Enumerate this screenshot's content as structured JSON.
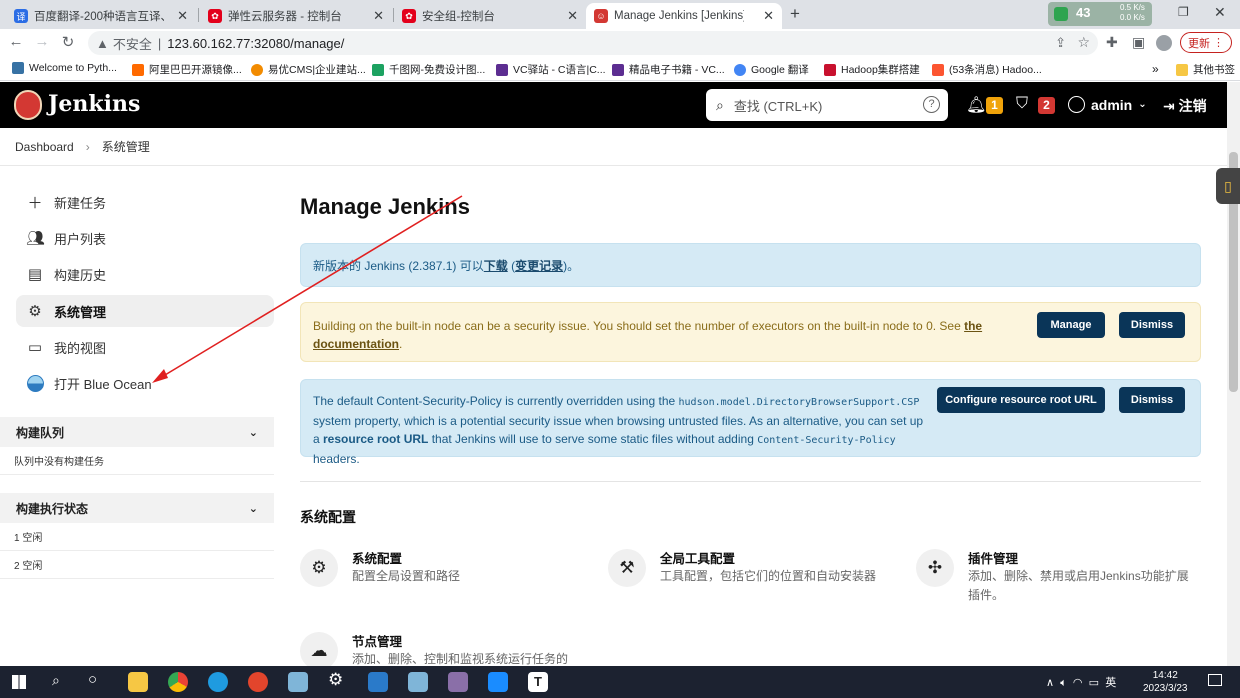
{
  "browser": {
    "tabs": [
      {
        "title": "百度翻译-200种语言互译、沟通",
        "icon": "baidu-translate-icon",
        "color": "#2b6de5"
      },
      {
        "title": "弹性云服务器 - 控制台",
        "icon": "huawei-icon",
        "color": "#e3001b"
      },
      {
        "title": "安全组-控制台",
        "icon": "huawei-icon",
        "color": "#e3001b"
      },
      {
        "title": "Manage Jenkins [Jenkins]",
        "icon": "jenkins-icon",
        "color": "#d33833"
      }
    ],
    "new_tab": "+",
    "url_warning": "不安全",
    "url": "123.60.162.77:32080/manage/",
    "update_label": "更新",
    "net_speed_up": "0.5 K/s",
    "net_speed_down": "0.0 K/s",
    "battery": "43",
    "bookmarks": [
      {
        "label": "Welcome to Pyth...",
        "color": "#3772a4"
      },
      {
        "label": "阿里巴巴开源镜像...",
        "color": "#ff6a00"
      },
      {
        "label": "易优CMS|企业建站...",
        "color": "#f28b00"
      },
      {
        "label": "千图网-免费设计图...",
        "color": "#1ca261"
      },
      {
        "label": "VC驿站 - C语言|C...",
        "color": "#5c2d91"
      },
      {
        "label": "精品电子书籍 - VC...",
        "color": "#5c2d91"
      },
      {
        "label": "Google 翻译",
        "color": "#4285f4"
      },
      {
        "label": "Hadoop集群搭建",
        "color": "#c8102e"
      },
      {
        "label": "(53条消息) Hadoo...",
        "color": "#fc5531"
      }
    ],
    "more_bookmarks": "»",
    "other_bookmarks": "其他书签"
  },
  "jenkins": {
    "brand": "Jenkins",
    "search_placeholder": "查找 (CTRL+K)",
    "notifications_count": "1",
    "security_count": "2",
    "user": "admin",
    "logout": "注销",
    "breadcrumb": [
      "Dashboard",
      "系统管理"
    ],
    "side_tasks": [
      {
        "label": "新建任务",
        "icon": "plus-icon"
      },
      {
        "label": "用户列表",
        "icon": "people-icon"
      },
      {
        "label": "构建历史",
        "icon": "history-icon"
      },
      {
        "label": "系统管理",
        "icon": "gear-icon"
      },
      {
        "label": "我的视图",
        "icon": "window-icon"
      },
      {
        "label": "打开 Blue Ocean",
        "icon": "blue-ocean-icon"
      }
    ],
    "build_queue": {
      "title": "构建队列",
      "empty": "队列中没有构建任务"
    },
    "executors": {
      "title": "构建执行状态",
      "rows": [
        "1  空闲",
        "2  空闲"
      ]
    },
    "page_title": "Manage Jenkins",
    "alerts": {
      "update": {
        "prefix": "新版本的 Jenkins (2.387.1) 可以",
        "download": "下载",
        "space": " (",
        "changelog": "变更记录",
        "suffix": ")。"
      },
      "builtin": {
        "text": "Building on the built-in node can be a security issue. You should set the number of executors on the built-in node to 0. See ",
        "link": "the documentation",
        "end": ".",
        "manage": "Manage",
        "dismiss": "Dismiss"
      },
      "csp": {
        "t1": "The default Content-Security-Policy is currently overridden using the ",
        "code1": "hudson.model.DirectoryBrowserSupport.CSP",
        "t2": " system property, which is a potential security issue when browsing untrusted files. As an alternative, you can set up a ",
        "link": "resource root URL",
        "t3": " that Jenkins will use to serve some static files without adding ",
        "code2": "Content-Security-Policy",
        "t4": " headers.",
        "configure": "Configure resource root URL",
        "dismiss": "Dismiss"
      }
    },
    "section_title": "系统配置",
    "config_items": [
      {
        "title": "系统配置",
        "desc": "配置全局设置和路径",
        "icon": "gear-icon"
      },
      {
        "title": "全局工具配置",
        "desc": "工具配置，包括它们的位置和自动安装器",
        "icon": "hammer-icon"
      },
      {
        "title": "插件管理",
        "desc": "添加、删除、禁用或启用Jenkins功能扩展插件。",
        "icon": "puzzle-icon"
      },
      {
        "title": "节点管理",
        "desc": "添加、删除、控制和监视系统运行任务的",
        "icon": "cloud-icon"
      }
    ]
  },
  "taskbar": {
    "time": "14:42",
    "date": "2023/3/23",
    "ime": "英",
    "tray_caret": "∧"
  }
}
